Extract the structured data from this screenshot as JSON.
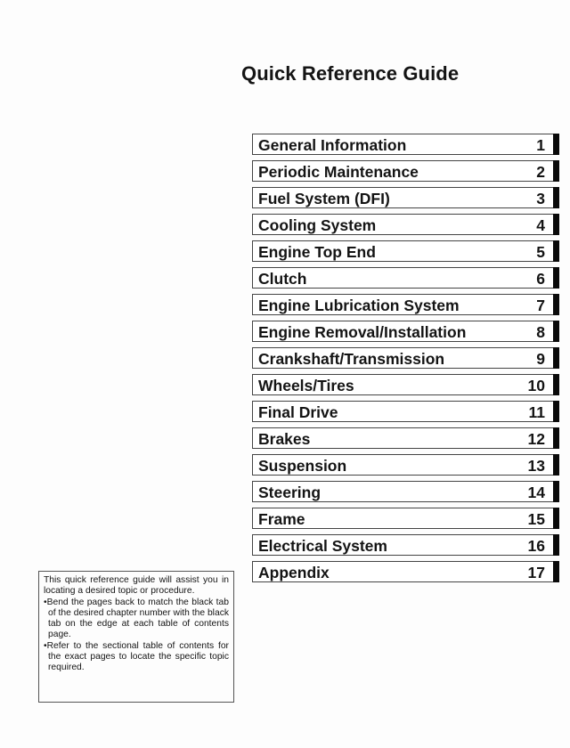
{
  "title": "Quick Reference Guide",
  "chapters": [
    {
      "label": "General Information",
      "number": "1"
    },
    {
      "label": "Periodic Maintenance",
      "number": "2"
    },
    {
      "label": "Fuel System (DFI)",
      "number": "3"
    },
    {
      "label": "Cooling System",
      "number": "4"
    },
    {
      "label": "Engine Top End",
      "number": "5"
    },
    {
      "label": "Clutch",
      "number": "6"
    },
    {
      "label": "Engine Lubrication System",
      "number": "7"
    },
    {
      "label": "Engine Removal/Installation",
      "number": "8"
    },
    {
      "label": "Crankshaft/Transmission",
      "number": "9"
    },
    {
      "label": "Wheels/Tires",
      "number": "10"
    },
    {
      "label": "Final Drive",
      "number": "11"
    },
    {
      "label": "Brakes",
      "number": "12"
    },
    {
      "label": "Suspension",
      "number": "13"
    },
    {
      "label": "Steering",
      "number": "14"
    },
    {
      "label": "Frame",
      "number": "15"
    },
    {
      "label": "Electrical System",
      "number": "16"
    },
    {
      "label": "Appendix",
      "number": "17"
    }
  ],
  "note": {
    "intro": "This quick reference guide will assist you in locating a desired topic or procedure.",
    "bullets": [
      "•Bend the pages back to match the black tab of the desired chapter number with the black tab on the edge at each table of contents page.",
      "•Refer to the sectional table of contents for the exact pages to locate the specific topic required."
    ]
  }
}
